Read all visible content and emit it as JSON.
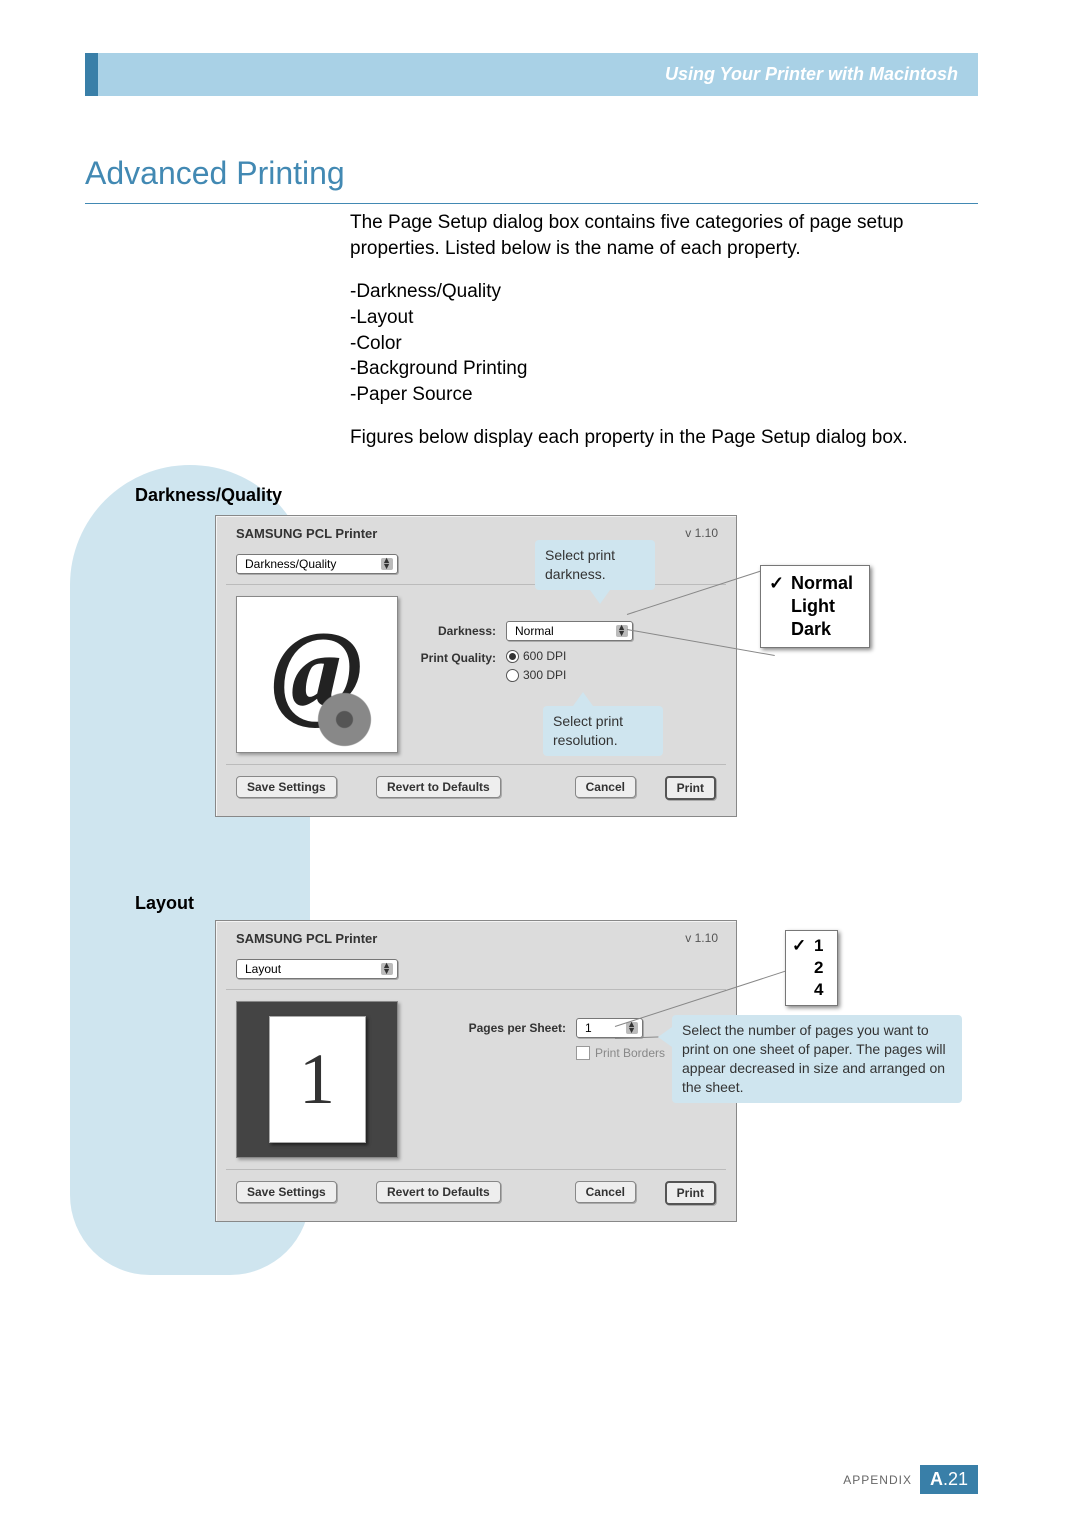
{
  "header": {
    "section_title": "Using Your Printer with Macintosh"
  },
  "title": "Advanced Printing",
  "intro": "The Page Setup dialog box contains five categories of page setup properties. Listed below is the name of each property.",
  "properties_list": [
    "-Darkness/Quality",
    "-Layout",
    "-Color",
    "-Background Printing",
    "-Paper Source"
  ],
  "intro_after": "Figures below display each property in the Page Setup dialog box.",
  "sections": {
    "darkness_quality": "Darkness/Quality",
    "layout": "Layout"
  },
  "dialog1": {
    "printer_name": "SAMSUNG PCL Printer",
    "version": "v 1.10",
    "tab_selected": "Darkness/Quality",
    "labels": {
      "darkness": "Darkness:",
      "print_quality": "Print Quality:"
    },
    "darkness_value": "Normal",
    "quality_options": {
      "opt600": "600 DPI",
      "opt300": "300 DPI"
    },
    "quality_selected": "600 DPI",
    "buttons": {
      "save": "Save Settings",
      "revert": "Revert to Defaults",
      "cancel": "Cancel",
      "print": "Print"
    }
  },
  "callouts": {
    "darkness": "Select print darkness.",
    "resolution": "Select print resolution.",
    "pages": "Select the number of pages you want to print on one sheet of paper. The pages will appear decreased in size and arranged on the sheet."
  },
  "popup_darkness": {
    "options": [
      "Normal",
      "Light",
      "Dark"
    ],
    "selected": "Normal"
  },
  "dialog2": {
    "printer_name": "SAMSUNG PCL Printer",
    "version": "v 1.10",
    "tab_selected": "Layout",
    "labels": {
      "pps": "Pages per Sheet:",
      "borders": "Print Borders"
    },
    "pps_value": "1",
    "preview_digit": "1",
    "buttons": {
      "save": "Save Settings",
      "revert": "Revert to Defaults",
      "cancel": "Cancel",
      "print": "Print"
    }
  },
  "popup_pages": {
    "options": [
      "1",
      "2",
      "4"
    ],
    "selected": "1"
  },
  "footer": {
    "appendix": "APPENDIX",
    "page_prefix": "A",
    "page_number": ".21"
  }
}
